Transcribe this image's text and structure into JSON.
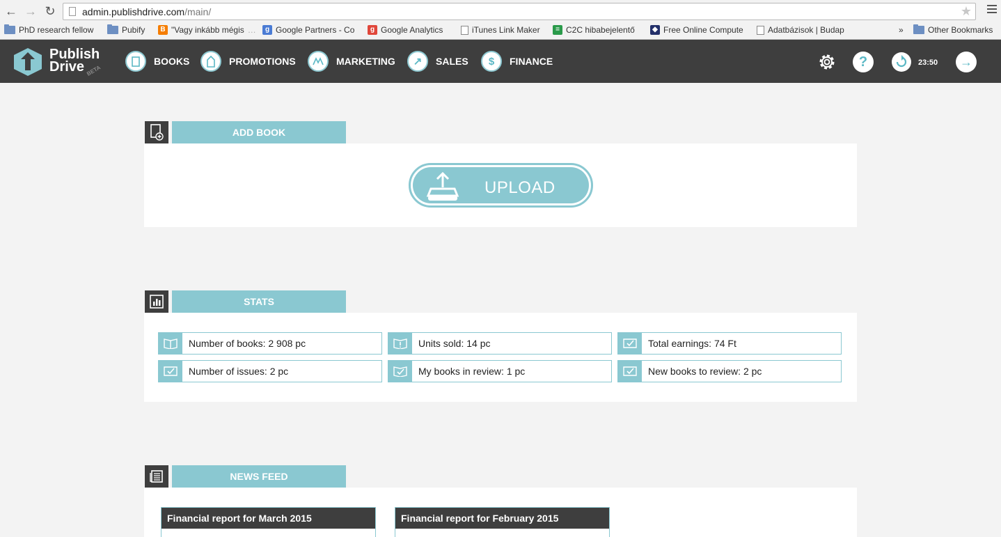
{
  "browser": {
    "url_host": "admin.publishdrive.com",
    "url_path": "/main/",
    "bookmarks": [
      {
        "label": "PhD research fellow",
        "icon": "folder-icon"
      },
      {
        "label": "Pubify",
        "icon": "folder-icon"
      },
      {
        "label": "\"Vagy inkább mégis",
        "fade": "…",
        "icon": "blogger-icon"
      },
      {
        "label": "Google Partners - Co",
        "icon": "google-icon"
      },
      {
        "label": "Google Analytics",
        "icon": "google-icon"
      },
      {
        "label": "iTunes Link Maker",
        "icon": "page-icon"
      },
      {
        "label": "C2C hibabejelentő",
        "icon": "sheets-icon"
      },
      {
        "label": "Free Online Compute",
        "icon": "shield-icon"
      },
      {
        "label": "Adatbázisok | Budap",
        "icon": "page-icon"
      },
      {
        "label": "Other Bookmarks",
        "icon": "folder-icon"
      }
    ],
    "overflow": "»"
  },
  "header": {
    "logo_line1": "Publish",
    "logo_line2": "Drive",
    "logo_beta": "BETA",
    "nav": [
      {
        "label": "BOOKS"
      },
      {
        "label": "PROMOTIONS"
      },
      {
        "label": "MARKETING"
      },
      {
        "label": "SALES"
      },
      {
        "label": "FINANCE"
      }
    ],
    "time": "23:50",
    "help": "?"
  },
  "add_book": {
    "title": "ADD BOOK",
    "upload_label": "UPLOAD"
  },
  "stats": {
    "title": "STATS",
    "items": [
      {
        "text": "Number of books: 2 908 pc",
        "icon": "book-icon"
      },
      {
        "text": "Units sold: 14 pc",
        "icon": "alert-book-icon"
      },
      {
        "text": "Total earnings: 74 Ft",
        "icon": "check-icon"
      },
      {
        "text": "Number of issues: 2 pc",
        "icon": "check-icon"
      },
      {
        "text": "My books in review: 1 pc",
        "icon": "check-book-icon"
      },
      {
        "text": "New books to review: 2 pc",
        "icon": "check-icon"
      }
    ]
  },
  "news": {
    "title": "NEWS FEED",
    "cards": [
      {
        "title": "Financial report for March 2015"
      },
      {
        "title": "Financial report for February 2015"
      }
    ]
  },
  "colors": {
    "accent": "#8ac8d1",
    "dark": "#3e3e3e"
  }
}
